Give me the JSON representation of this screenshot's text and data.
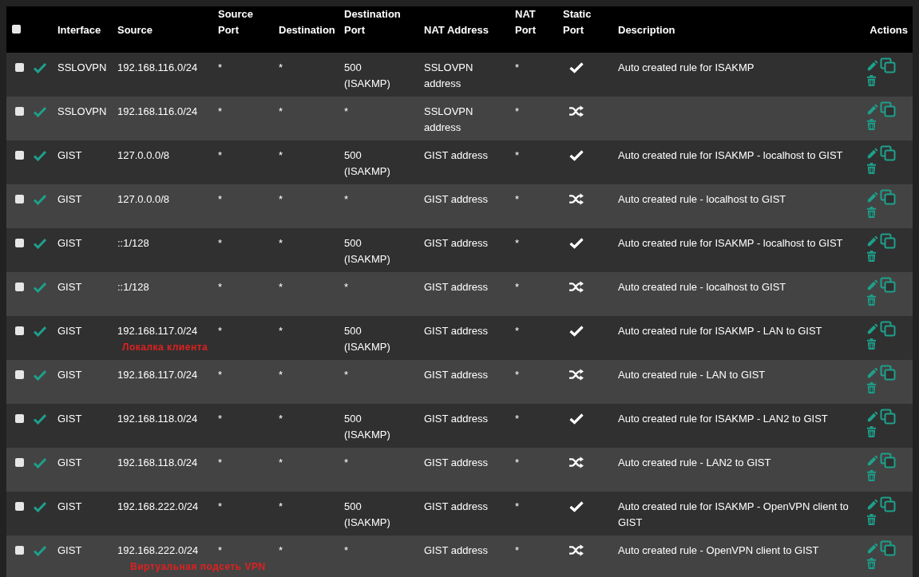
{
  "table": {
    "columns": [
      {
        "label": "Interface"
      },
      {
        "label": "Source"
      },
      {
        "label": "Source Port"
      },
      {
        "label": "Destination"
      },
      {
        "label": "Destination Port"
      },
      {
        "label": "NAT Address"
      },
      {
        "label": "NAT Port"
      },
      {
        "label": "Static Port"
      },
      {
        "label": "Description"
      },
      {
        "label": "Actions"
      }
    ],
    "select_all_checked": false,
    "rows": [
      {
        "checked": false,
        "enabled": true,
        "interface": "SSLOVPN",
        "source": "192.168.116.0/24",
        "source_port": "*",
        "destination": "*",
        "destination_port": "500 (ISAKMP)",
        "nat_address": "SSLOVPN address",
        "nat_port": "*",
        "static_port": true,
        "description": "Auto created rule for ISAKMP"
      },
      {
        "checked": false,
        "enabled": true,
        "interface": "SSLOVPN",
        "source": "192.168.116.0/24",
        "source_port": "*",
        "destination": "*",
        "destination_port": "*",
        "nat_address": "SSLOVPN address",
        "nat_port": "*",
        "static_port": false
      },
      {
        "checked": false,
        "enabled": true,
        "interface": "GIST",
        "source": "127.0.0.0/8",
        "source_port": "*",
        "destination": "*",
        "destination_port": "500 (ISAKMP)",
        "nat_address": "GIST address",
        "nat_port": "*",
        "static_port": true,
        "description": "Auto created rule for ISAKMP - localhost to GIST"
      },
      {
        "checked": false,
        "enabled": true,
        "interface": "GIST",
        "source": "127.0.0.0/8",
        "source_port": "*",
        "destination": "*",
        "destination_port": "*",
        "nat_address": "GIST address",
        "nat_port": "*",
        "static_port": false,
        "description": "Auto created rule - localhost to GIST"
      },
      {
        "checked": false,
        "enabled": true,
        "interface": "GIST",
        "source": "::1/128",
        "source_port": "*",
        "destination": "*",
        "destination_port": "500 (ISAKMP)",
        "nat_address": "GIST address",
        "nat_port": "*",
        "static_port": true,
        "description": "Auto created rule for ISAKMP - localhost to GIST"
      },
      {
        "checked": false,
        "enabled": true,
        "interface": "GIST",
        "source": "::1/128",
        "source_port": "*",
        "destination": "*",
        "destination_port": "*",
        "nat_address": "GIST address",
        "nat_port": "*",
        "static_port": false,
        "description": "Auto created rule - localhost to GIST"
      },
      {
        "checked": false,
        "enabled": true,
        "interface": "GIST",
        "source": "192.168.117.0/24",
        "source_note": "Локалка клиента",
        "source_port": "*",
        "destination": "*",
        "destination_port": "500 (ISAKMP)",
        "nat_address": "GIST address",
        "nat_port": "*",
        "static_port": true,
        "description": "Auto created rule for ISAKMP - LAN to GIST"
      },
      {
        "checked": false,
        "enabled": true,
        "interface": "GIST",
        "source": "192.168.117.0/24",
        "source_port": "*",
        "destination": "*",
        "destination_port": "*",
        "nat_address": "GIST address",
        "nat_port": "*",
        "static_port": false,
        "description": "Auto created rule - LAN to GIST"
      },
      {
        "checked": false,
        "enabled": true,
        "interface": "GIST",
        "source": "192.168.118.0/24",
        "source_port": "*",
        "destination": "*",
        "destination_port": "500 (ISAKMP)",
        "nat_address": "GIST address",
        "nat_port": "*",
        "static_port": true,
        "description": "Auto created rule for ISAKMP - LAN2 to GIST"
      },
      {
        "checked": false,
        "enabled": true,
        "interface": "GIST",
        "source": "192.168.118.0/24",
        "source_port": "*",
        "destination": "*",
        "destination_port": "*",
        "nat_address": "GIST address",
        "nat_port": "*",
        "static_port": false,
        "description": "Auto created rule - LAN2 to GIST"
      },
      {
        "checked": false,
        "enabled": true,
        "interface": "GIST",
        "source": "192.168.222.0/24",
        "source_port": "*",
        "destination": "*",
        "destination_port": "500 (ISAKMP)",
        "nat_address": "GIST address",
        "nat_port": "*",
        "static_port": true,
        "description": "Auto created rule for ISAKMP - OpenVPN client to GIST"
      },
      {
        "checked": false,
        "enabled": true,
        "interface": "GIST",
        "source": "192.168.222.0/24",
        "source_note": "Виртуальная подсеть VPN",
        "source_port": "*",
        "destination": "*",
        "destination_port": "*",
        "nat_address": "GIST address",
        "nat_port": "*",
        "static_port": false,
        "description": "Auto created rule - OpenVPN client to GIST"
      }
    ]
  }
}
